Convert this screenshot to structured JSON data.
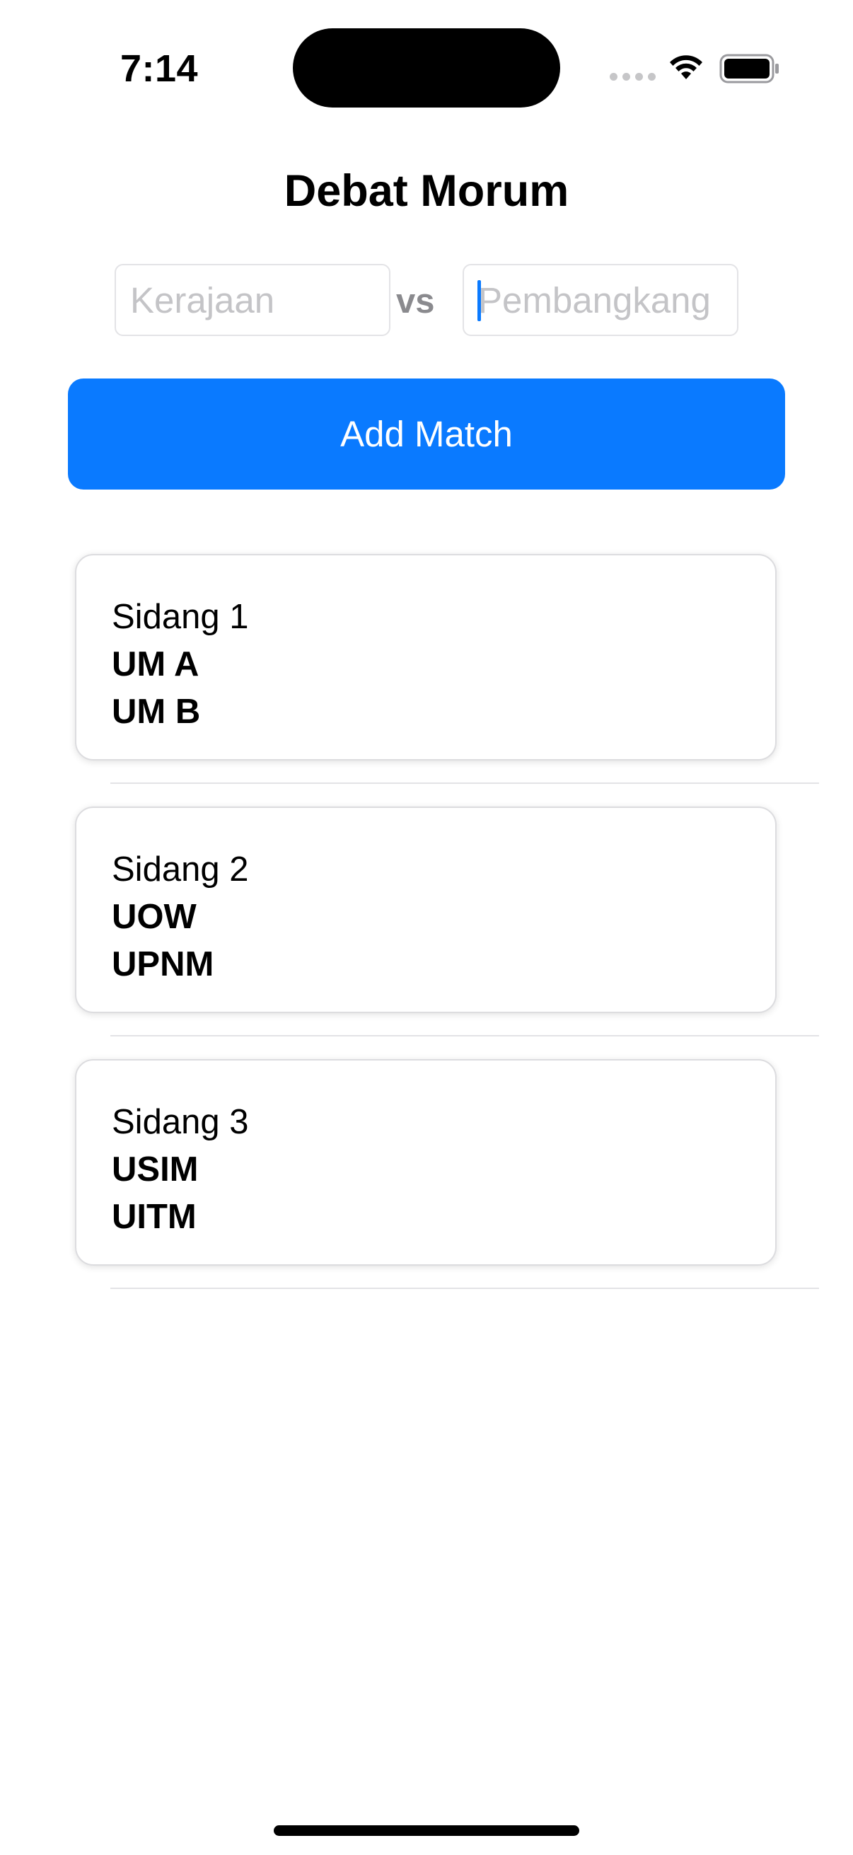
{
  "status_bar": {
    "time": "7:14",
    "icons": [
      "cellular-signal-icon",
      "wifi-icon",
      "battery-icon"
    ]
  },
  "title": "Debat Morum",
  "form": {
    "left_placeholder": "Kerajaan",
    "left_value": "",
    "right_placeholder": "Pembangkang",
    "right_value": "",
    "vs_label": "vs",
    "add_button_label": "Add Match"
  },
  "colors": {
    "accent": "#0a7aff",
    "placeholder": "#c4c4c7",
    "vs": "#8a8a8e"
  },
  "matches": [
    {
      "court": "Sidang 1",
      "team_a": "UM A",
      "team_b": "UM B"
    },
    {
      "court": "Sidang 2",
      "team_a": "UOW",
      "team_b": "UPNM"
    },
    {
      "court": "Sidang 3",
      "team_a": "USIM",
      "team_b": "UITM"
    }
  ]
}
